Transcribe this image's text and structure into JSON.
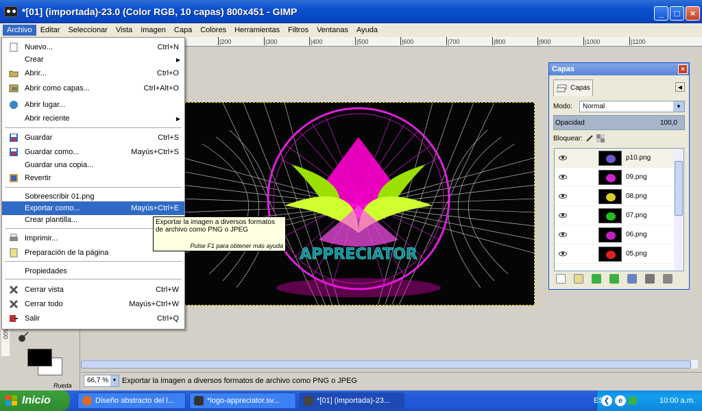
{
  "window": {
    "title": "*[01] (importada)-23.0 (Color RGB, 10 capas) 800x451 - GIMP",
    "minimize_glyph": "_",
    "maximize_glyph": "□",
    "close_glyph": "×"
  },
  "menubar": {
    "items": [
      "Archivo",
      "Editar",
      "Seleccionar",
      "Vista",
      "Imagen",
      "Capa",
      "Colores",
      "Herramientas",
      "Filtros",
      "Ventanas",
      "Ayuda"
    ]
  },
  "ruler": {
    "ticks": [
      "|200",
      "|300",
      "|400",
      "|500",
      "|600",
      "|700",
      "|800",
      "|900",
      "|1000",
      "|1100"
    ],
    "vertical": "500"
  },
  "file_menu": {
    "items": [
      {
        "label": "Nuevo...",
        "shortcut": "Ctrl+N",
        "icon": "new-icon"
      },
      {
        "label": "Crear",
        "shortcut": "",
        "submenu": true
      },
      {
        "label": "Abrir...",
        "shortcut": "Ctrl+O",
        "icon": "open-icon"
      },
      {
        "label": "Abrir como capas...",
        "shortcut": "Ctrl+Alt+O",
        "icon": "open-layers-icon"
      },
      {
        "label": "Abrir lugar...",
        "shortcut": "",
        "icon": "globe-icon"
      },
      {
        "label": "Abrir reciente",
        "shortcut": "",
        "submenu": true
      },
      {
        "label": "Guardar",
        "shortcut": "Ctrl+S",
        "icon": "save-icon"
      },
      {
        "label": "Guardar como...",
        "shortcut": "Mayús+Ctrl+S",
        "icon": "save-as-icon"
      },
      {
        "label": "Guardar una copia...",
        "shortcut": ""
      },
      {
        "label": "Revertir",
        "shortcut": "",
        "icon": "revert-icon"
      },
      {
        "label": "Sobreescribir 01.png",
        "shortcut": ""
      },
      {
        "label": "Exportar como...",
        "shortcut": "Mayús+Ctrl+E",
        "highlighted": true
      },
      {
        "label": "Crear plantilla...",
        "shortcut": ""
      },
      {
        "label": "Imprimir...",
        "shortcut": "",
        "icon": "print-icon"
      },
      {
        "label": "Preparación de la página",
        "shortcut": "",
        "icon": "page-setup-icon"
      },
      {
        "label": "Propiedades",
        "shortcut": ""
      },
      {
        "label": "Cerrar vista",
        "shortcut": "Ctrl+W",
        "icon": "close-view-icon"
      },
      {
        "label": "Cerrar todo",
        "shortcut": "Mayús+Ctrl+W",
        "icon": "close-all-icon"
      },
      {
        "label": "Salir",
        "shortcut": "Ctrl+Q",
        "icon": "quit-icon"
      }
    ]
  },
  "tooltip": {
    "text_line1": "Exportar la imagen a diversos formatos",
    "text_line2": "de archivo como PNG o JPEG",
    "hint": "Pulse F1 para obtener más ayuda"
  },
  "canvas": {
    "logo_text": "APPRECIATOR"
  },
  "layers_dock": {
    "title": "Capas",
    "tab_label": "Capas",
    "mode_label": "Modo:",
    "mode_value": "Normal",
    "opacity_label": "Opacidad",
    "opacity_value": "100,0",
    "lock_label": "Bloquear:",
    "layers": [
      {
        "name": "p10.png",
        "color": "#6a5acd"
      },
      {
        "name": "09.png",
        "color": "#d020d0"
      },
      {
        "name": "08.png",
        "color": "#d8d020"
      },
      {
        "name": "07.png",
        "color": "#20c020"
      },
      {
        "name": "06.png",
        "color": "#c020c0"
      },
      {
        "name": "05.png",
        "color": "#e02020"
      }
    ]
  },
  "toolbox": {
    "fade_label": "Rueda"
  },
  "statusbar": {
    "zoom": "66,7 %",
    "message": "Exportar la imagen a diversos formatos de archivo como PNG o JPEG"
  },
  "taskbar": {
    "start_label": "Inicio",
    "tasks": [
      {
        "label": "Diseño abstracto del l...",
        "icon_color": "#e06a20"
      },
      {
        "label": "*logo-appreciator.sv...",
        "icon_color": "#333333"
      },
      {
        "label": "*[01] (importada)-23...",
        "icon_color": "#444444"
      }
    ],
    "lang": "ES",
    "clock": "10:00 a.m."
  }
}
